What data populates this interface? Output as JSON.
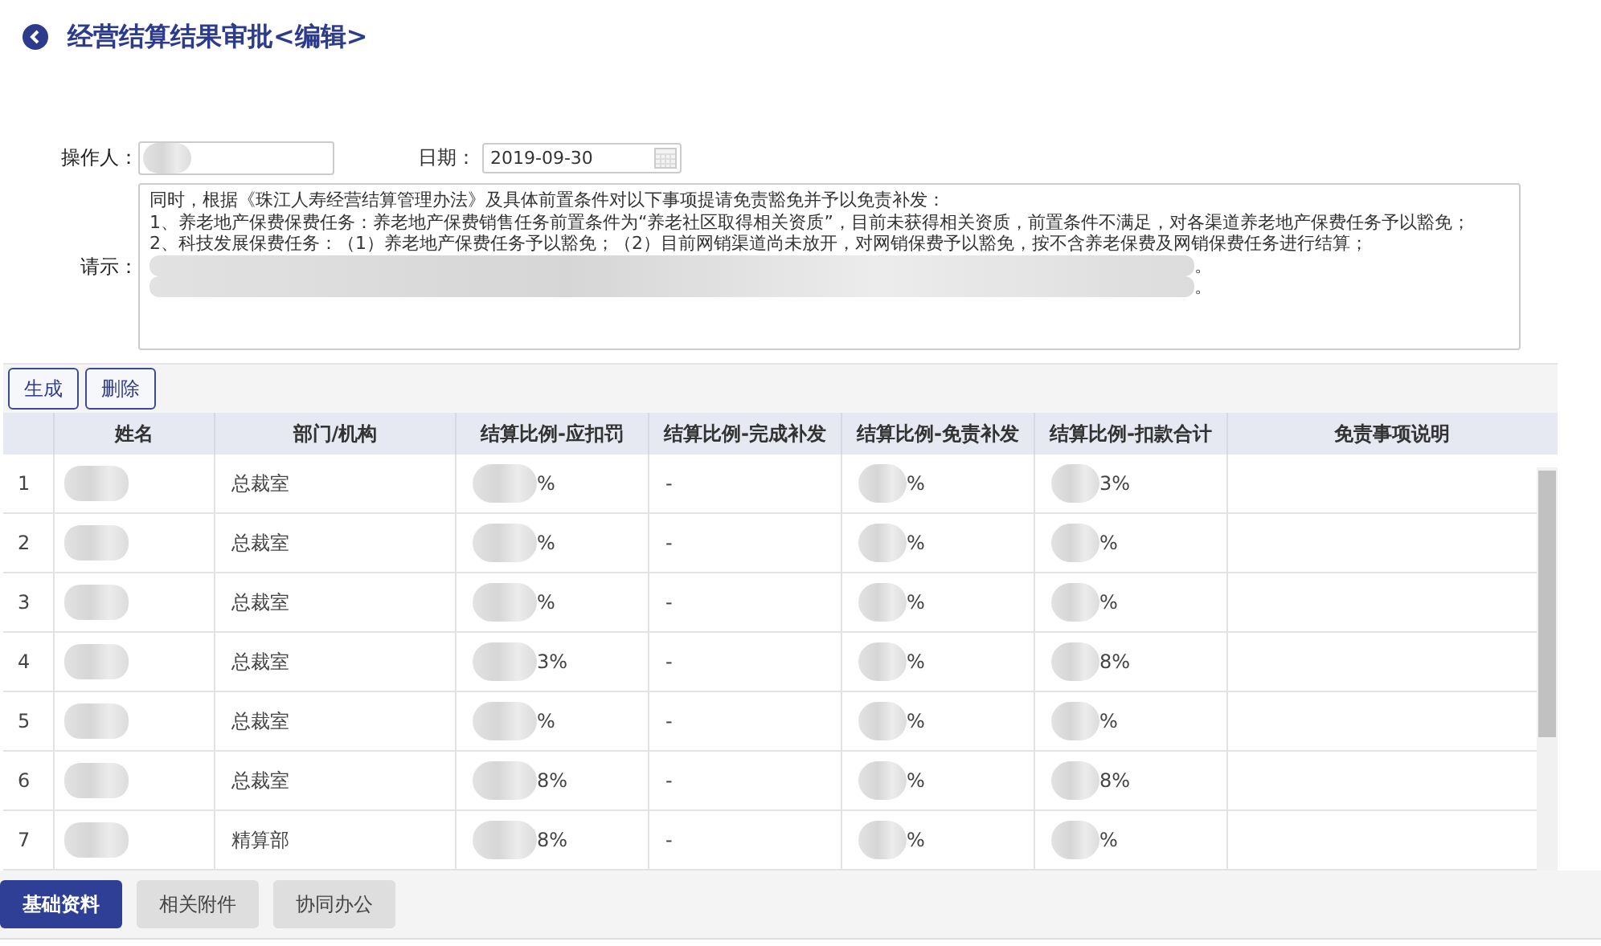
{
  "header": {
    "title": "经营结算结果审批<编辑>"
  },
  "form": {
    "operator_label": "操作人：",
    "date_label": "日期：",
    "date_value": "2019-09-30",
    "request_label": "请示：",
    "request_lines": [
      {
        "text": "同时，根据《珠江人寿经营结算管理办法》及具体前置条件对以下事项提请免责豁免并予以免责补发：",
        "redacted": false
      },
      {
        "text": "1、养老地产保费保费任务：养老地产保费销售任务前置条件为“养老社区取得相关资质”，目前未获得相关资质，前置条件不满足，对各渠道养老地产保费任务予以豁免；",
        "redacted": false
      },
      {
        "text": "2、科技发展保费任务：（1）养老地产保费任务予以豁免；（2）目前网销渠道尚未放开，对网销保费予以豁免，按不含养老保费及网销保费任务进行结算；",
        "redacted": false
      },
      {
        "text": "。",
        "redacted": true
      },
      {
        "text": "。",
        "redacted": true
      }
    ]
  },
  "toolbar": {
    "buttons": [
      "生成",
      "删除"
    ]
  },
  "table": {
    "columns": [
      "姓名",
      "部门/机构",
      "结算比例-应扣罚",
      "结算比例-完成补发",
      "结算比例-免责补发",
      "结算比例-扣款合计",
      "免责事项说明"
    ],
    "rows": [
      {
        "index": "1",
        "dept": "总裁室",
        "penalty": "%",
        "complete": "-",
        "exempt": "%",
        "total": "3%"
      },
      {
        "index": "2",
        "dept": "总裁室",
        "penalty": "%",
        "complete": "-",
        "exempt": "%",
        "total": "%"
      },
      {
        "index": "3",
        "dept": "总裁室",
        "penalty": "%",
        "complete": "-",
        "exempt": "%",
        "total": "%"
      },
      {
        "index": "4",
        "dept": "总裁室",
        "penalty": "3%",
        "complete": "-",
        "exempt": "%",
        "total": "8%"
      },
      {
        "index": "5",
        "dept": "总裁室",
        "penalty": "%",
        "complete": "-",
        "exempt": "%",
        "total": "%"
      },
      {
        "index": "6",
        "dept": "总裁室",
        "penalty": "8%",
        "complete": "-",
        "exempt": "%",
        "total": "8%"
      },
      {
        "index": "7",
        "dept": "精算部",
        "penalty": "8%",
        "complete": "-",
        "exempt": "%",
        "total": "%"
      }
    ]
  },
  "bottom_tabs": [
    {
      "label": "基础资料",
      "selected": true
    },
    {
      "label": "相关附件",
      "selected": false
    },
    {
      "label": "协同办公",
      "selected": false
    }
  ]
}
